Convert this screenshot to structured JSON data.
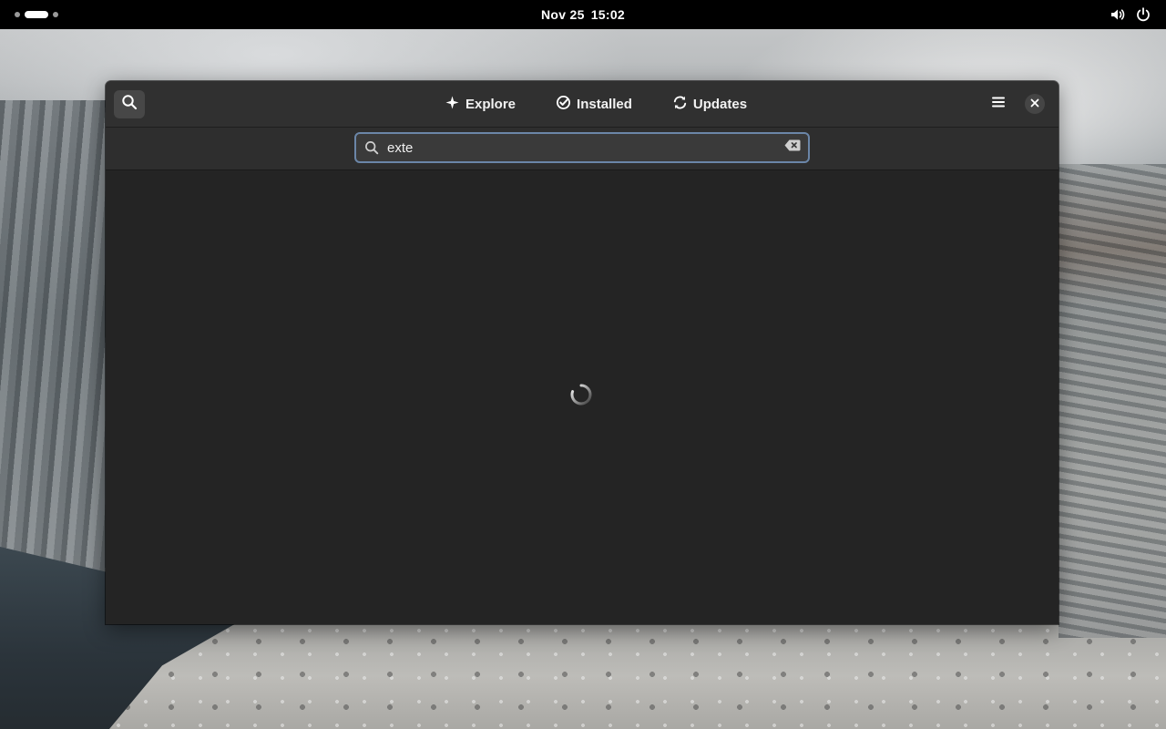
{
  "topbar": {
    "date": "Nov 25",
    "time": "15:02",
    "icons": [
      "volume-icon",
      "power-icon"
    ]
  },
  "window": {
    "nav": {
      "tabs": [
        {
          "label": "Explore",
          "icon": "explore-icon"
        },
        {
          "label": "Installed",
          "icon": "installed-icon"
        },
        {
          "label": "Updates",
          "icon": "updates-icon"
        }
      ]
    },
    "search": {
      "value": "exte"
    },
    "content": {
      "state": "loading"
    }
  }
}
